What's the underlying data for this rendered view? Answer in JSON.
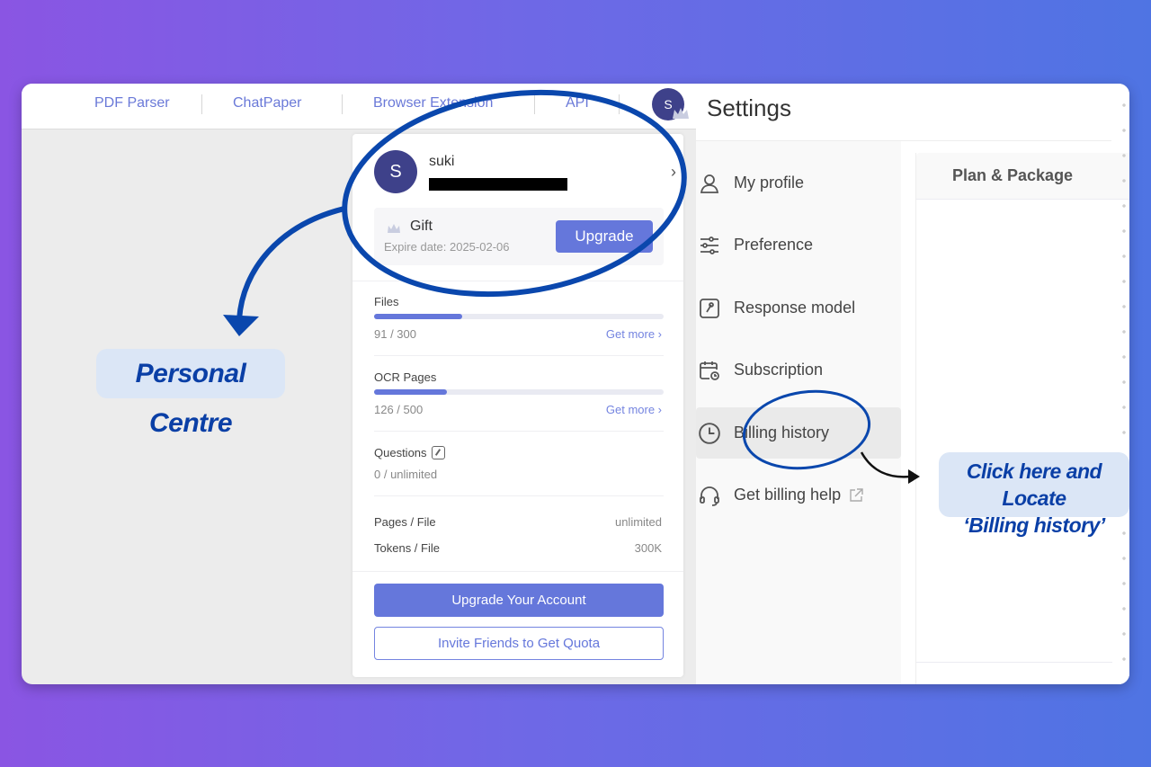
{
  "topnav": {
    "links": [
      {
        "label": "PDF Parser"
      },
      {
        "label": "ChatPaper"
      },
      {
        "label": "Browser Extension"
      },
      {
        "label": "API"
      }
    ],
    "avatar_initial": "S"
  },
  "profile_card": {
    "avatar_initial": "S",
    "username": "suki",
    "email_redacted": true,
    "plan": {
      "name": "Gift",
      "expire_text": "Expire date: 2025-02-06",
      "upgrade_label": "Upgrade"
    },
    "quotas": [
      {
        "label": "Files",
        "used": 91,
        "total": 300,
        "value_text": "91 / 300",
        "get_more_label": "Get more ›",
        "progress": 0.303
      },
      {
        "label": "OCR Pages",
        "used": 126,
        "total": 500,
        "value_text": "126 / 500",
        "get_more_label": "Get more ›",
        "progress": 0.252
      }
    ],
    "questions": {
      "label": "Questions",
      "value_text": "0 / unlimited"
    },
    "limits": [
      {
        "label": "Pages / File",
        "value": "unlimited"
      },
      {
        "label": "Tokens / File",
        "value": "300K"
      }
    ],
    "upgrade_account_label": "Upgrade Your Account",
    "invite_label": "Invite Friends to Get Quota"
  },
  "settings": {
    "title": "Settings",
    "menu": [
      {
        "label": "My profile",
        "icon": "user-icon"
      },
      {
        "label": "Preference",
        "icon": "sliders-icon"
      },
      {
        "label": "Response model",
        "icon": "key-icon"
      },
      {
        "label": "Subscription",
        "icon": "calendar-clock-icon"
      },
      {
        "label": "Billing history",
        "icon": "clock-icon",
        "active": true
      },
      {
        "label": "Get billing help",
        "icon": "headset-icon",
        "external": true
      }
    ],
    "panel_title": "Plan & Package"
  },
  "annotations": {
    "personal_centre": "Personal Centre",
    "billing_line1": "Click here and Locate",
    "billing_line2": "‘Billing history’"
  },
  "colors": {
    "accent": "#6577db",
    "avatar": "#3e418a",
    "annotation": "#0a3fa6",
    "callout_bg": "#dbe6f6"
  }
}
